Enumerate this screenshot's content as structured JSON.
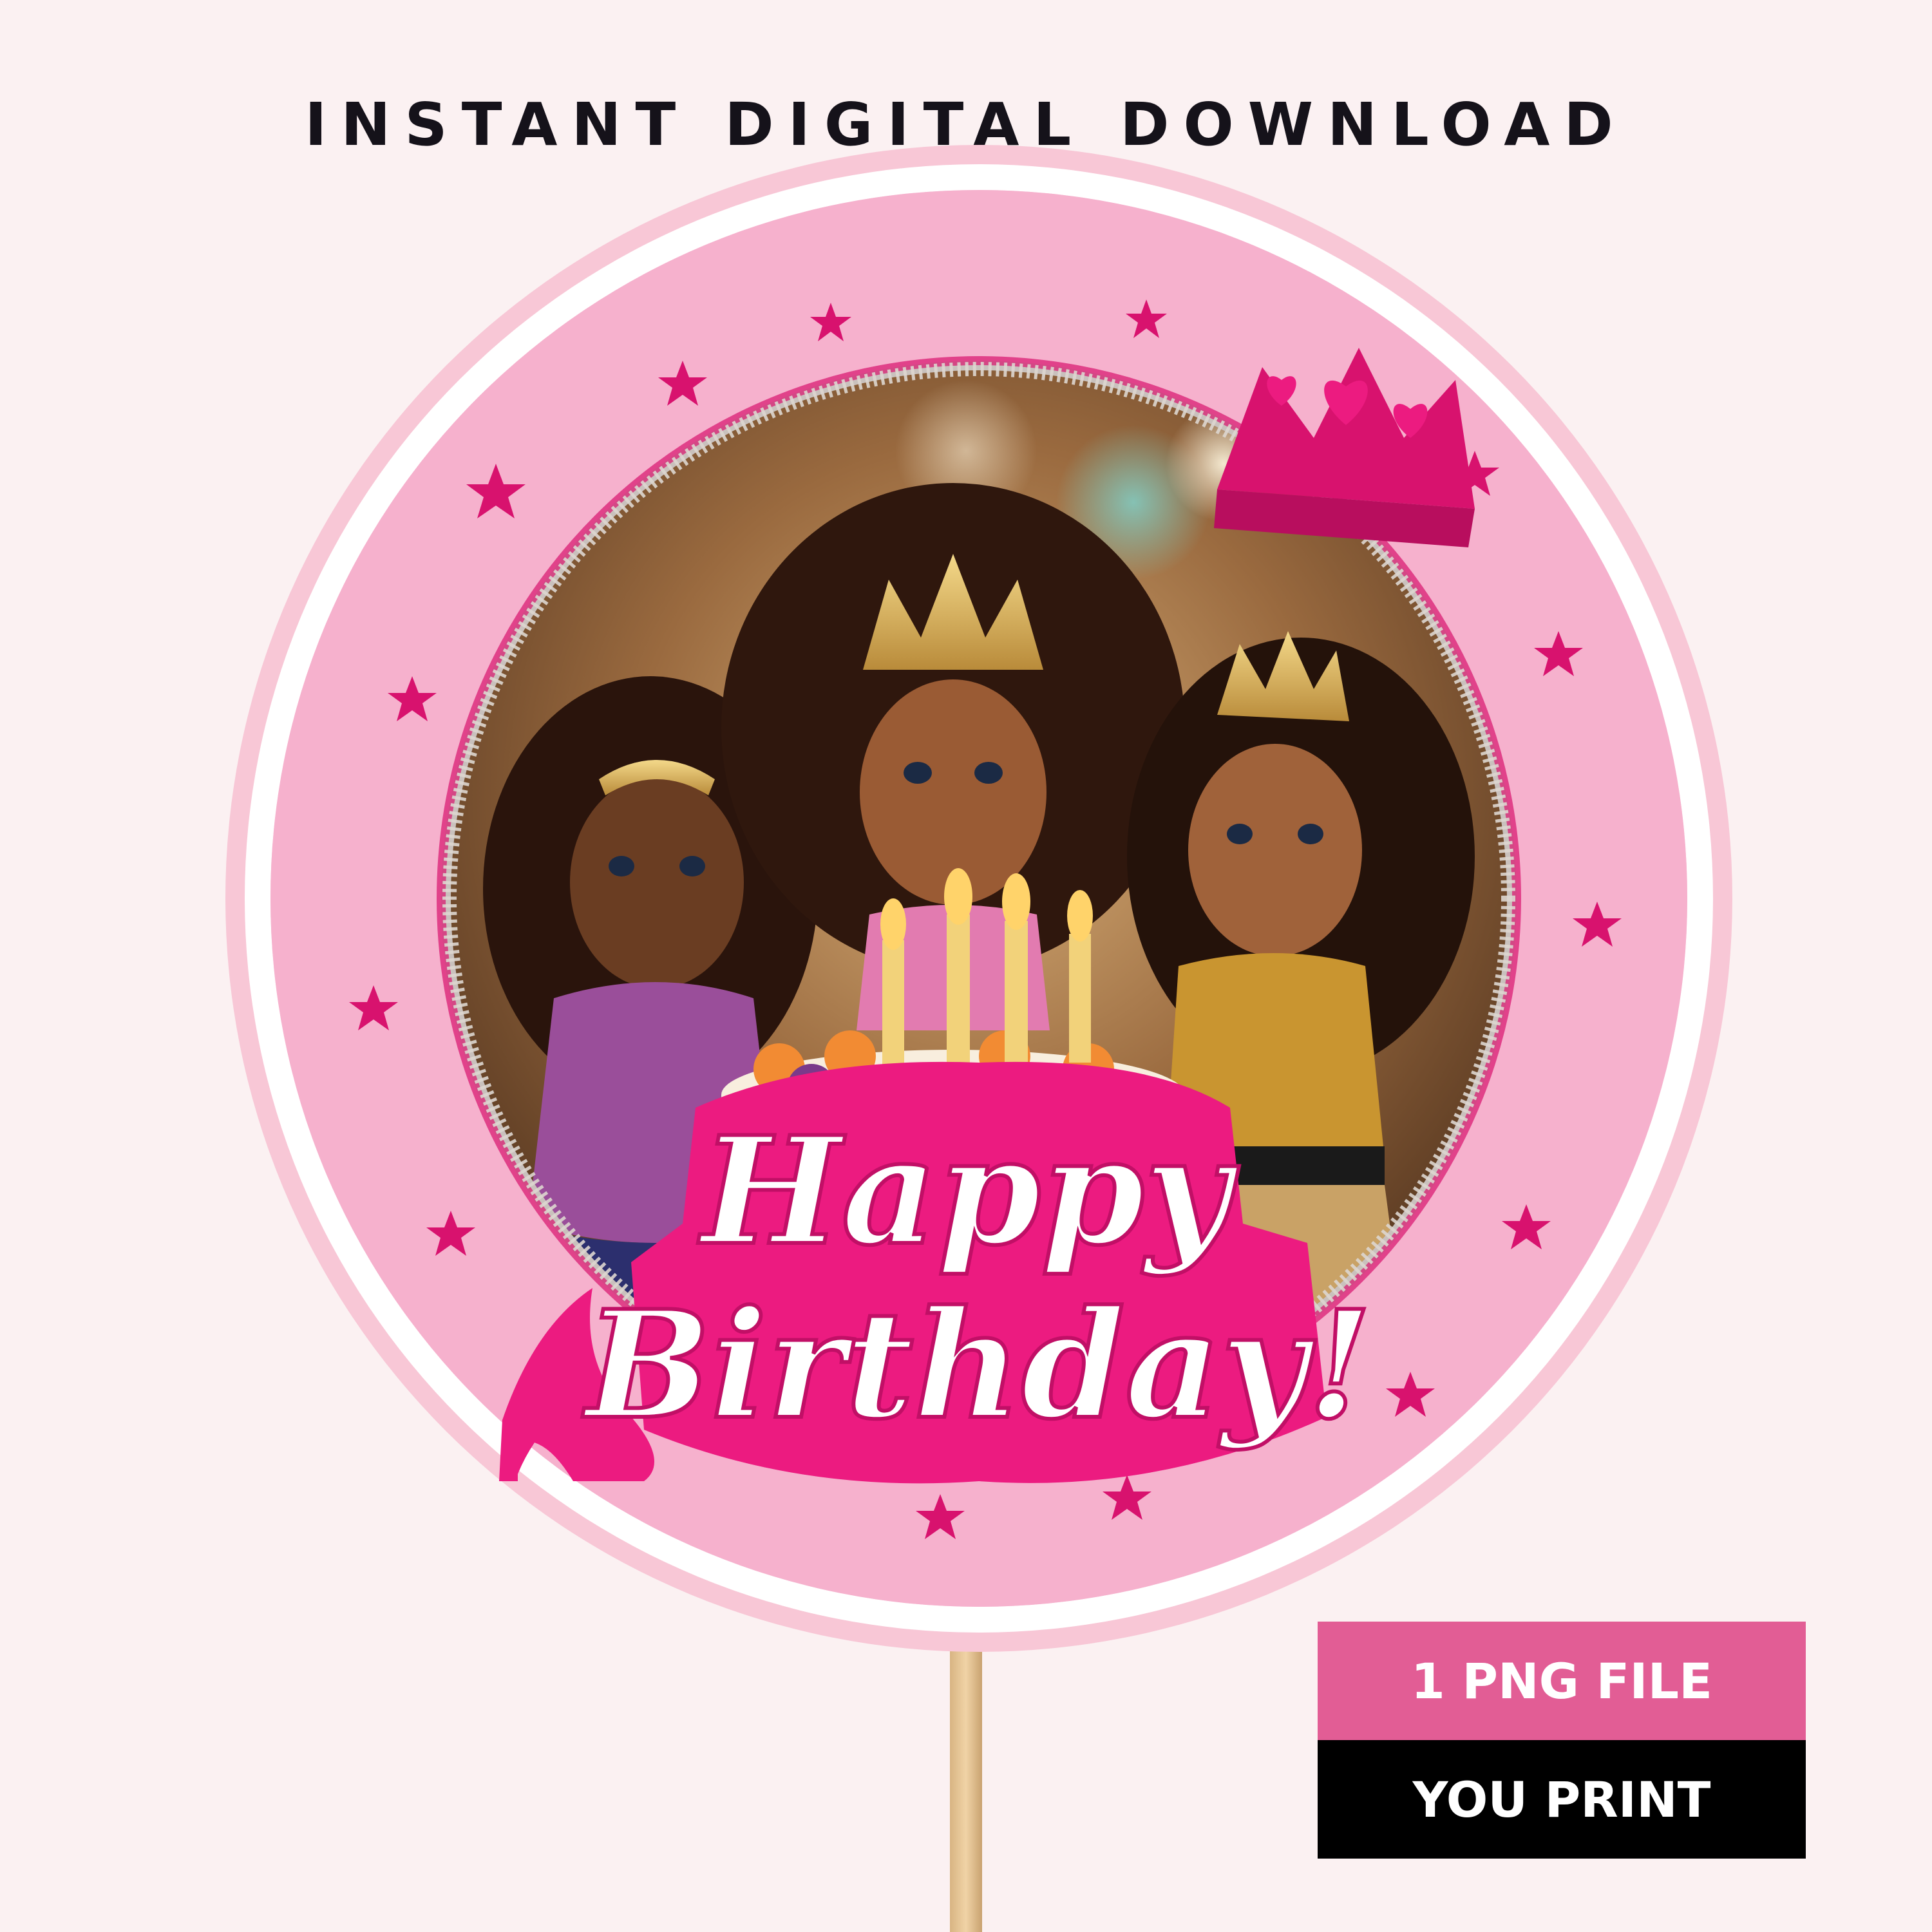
{
  "headline": "INSTANT DIGITAL DOWNLOAD",
  "topper": {
    "greeting_line1": "Happy",
    "greeting_line2": "Birthday!"
  },
  "badges": {
    "file": "1 PNG FILE",
    "print": "YOU PRINT"
  },
  "icons": [
    "crown-icon",
    "high-heel-icon",
    "star-icon"
  ],
  "colors": {
    "background": "#fbf1f2",
    "outer_pink": "#f8c7d6",
    "glitter_pink": "#f5a9c8",
    "hot_pink": "#ec1b80",
    "magenta": "#d8126e",
    "badge_pink": "#e25d95",
    "badge_black": "#000000"
  }
}
